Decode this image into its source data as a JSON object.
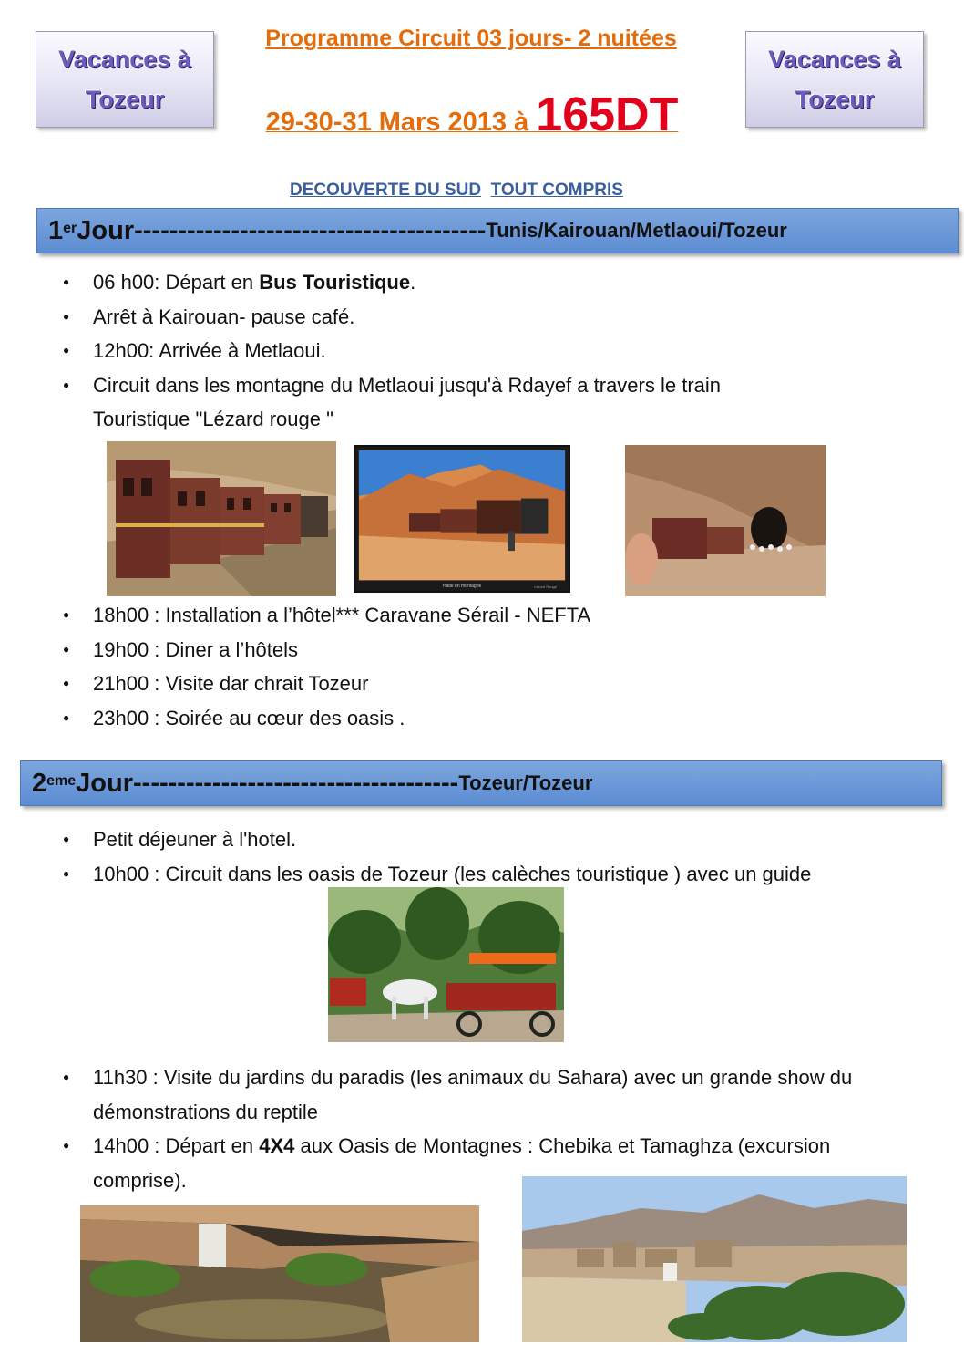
{
  "header": {
    "badge_left_line1": "Vacances à",
    "badge_left_line2": "Tozeur",
    "badge_right_line1": "Vacances à",
    "badge_right_line2": "Tozeur",
    "title_line1": "Programme Circuit 03 jours- 2 nuitées",
    "title_dates": "29-30-31 Mars 2013 à ",
    "title_price": "165DT",
    "subtitle_part1": "DECOUVERTE DU SUD",
    "subtitle_part2": "TOUT COMPRIS"
  },
  "day1": {
    "num": "1",
    "sup": "er",
    "word": " Jour",
    "dashes": "----------------------------------------",
    "route": "Tunis/Kairouan/Metlaoui/Tozeur",
    "items_a": [
      {
        "pre": "06 h00: Départ en ",
        "bold": "Bus Touristique",
        "post": "."
      },
      {
        "text": "Arrêt à Kairouan- pause café."
      },
      {
        "text": "12h00: Arrivée à Metlaoui."
      },
      {
        "text": "Circuit dans les montagne du Metlaoui jusqu'à  Rdayef  a travers le train Touristique  \"Lézard rouge \""
      }
    ],
    "items_b": [
      "18h00 : Installation a l’hôtel***  Caravane Sérail - NEFTA",
      "19h00 : Diner a l’hôtels",
      "21h00 : Visite dar chrait Tozeur",
      "23h00 : Soirée au cœur des oasis ."
    ],
    "photo2_caption_left": "Halte en montagne",
    "photo2_caption_right": "Lézard Rouge"
  },
  "day2": {
    "num": "2",
    "sup": "eme",
    "word": " Jour",
    "dashes": "-------------------------------------",
    "route": "Tozeur/Tozeur",
    "items_a": [
      "Petit déjeuner à l'hotel.",
      "10h00 : Circuit dans les oasis de Tozeur (les calèches touristique ) avec un guide"
    ],
    "items_b": [
      {
        "text": "11h30 : Visite du  jardins du paradis (les animaux du Sahara) avec un grande show du démonstrations du reptile"
      },
      {
        "pre": "14h00 : Départ en ",
        "bold": "4X4",
        "post": " aux Oasis de Montagnes : Chebika et Tamaghza (excursion comprise)."
      }
    ]
  },
  "colors": {
    "title_orange": "#e46c0a",
    "price_red": "#e3001b",
    "band_blue": "#5c8cd2",
    "subtitle_blue": "#3a5f9e",
    "badge_purple": "#6e5bbd"
  }
}
